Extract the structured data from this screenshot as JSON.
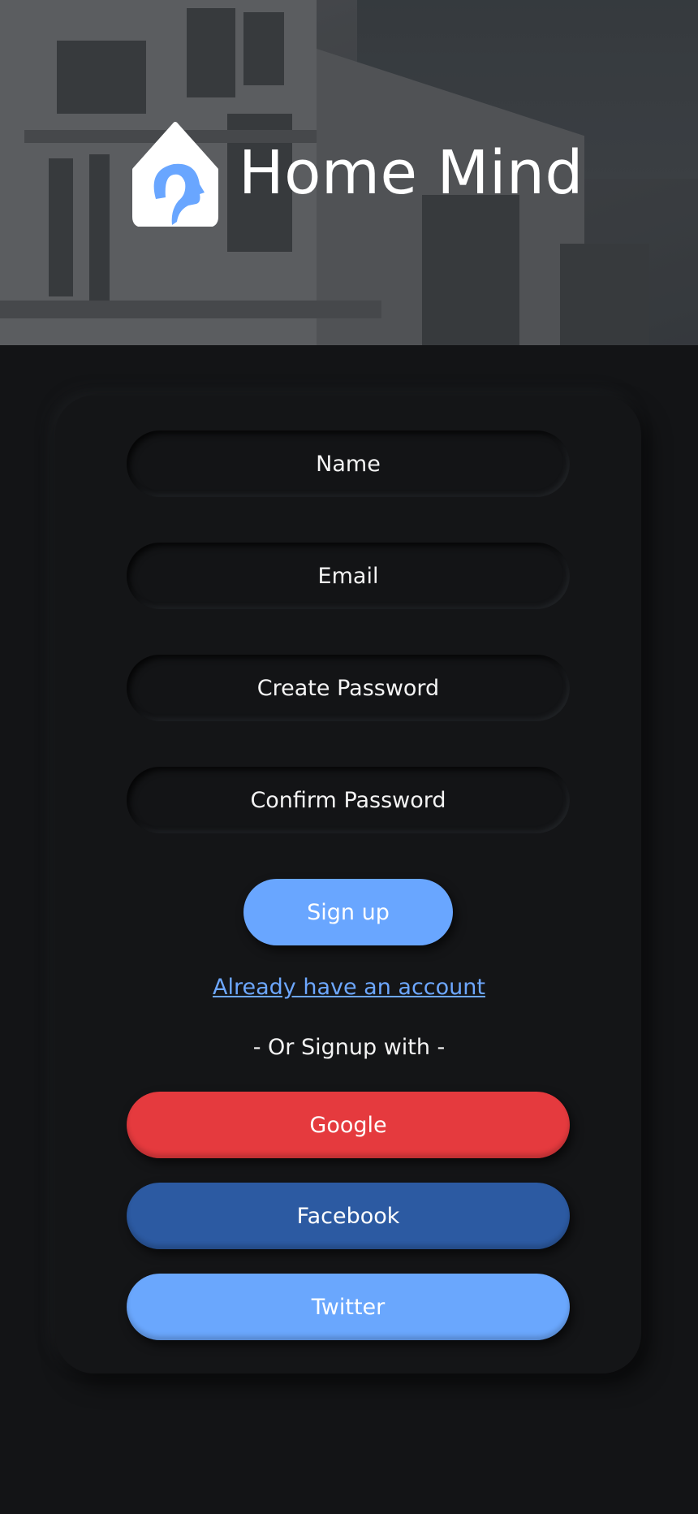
{
  "brand": {
    "name": "Home Mind",
    "logo_icon": "house-with-head-icon",
    "accent": "#69a6ff"
  },
  "form": {
    "name_placeholder": "Name",
    "email_placeholder": "Email",
    "create_password_placeholder": "Create Password",
    "confirm_password_placeholder": "Confirm Password",
    "signup_label": "Sign up",
    "signin_link": "Already have an account",
    "or_text": "- Or Signup with -"
  },
  "social": {
    "google_label": "Google",
    "facebook_label": "Facebook",
    "twitter_label": "Twitter",
    "google_color": "#e53a3e",
    "facebook_color": "#2c5aa2",
    "twitter_color": "#6aa7fd"
  }
}
